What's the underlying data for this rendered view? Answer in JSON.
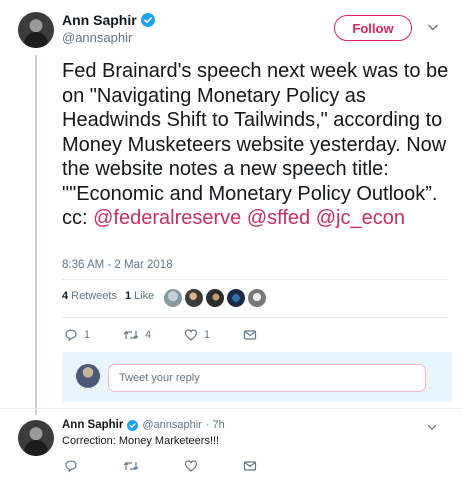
{
  "tweet": {
    "author_name": "Ann Saphir",
    "author_handle": "@annsaphir",
    "follow_label": "Follow",
    "text_parts": [
      "Fed Brainard's speech next week was to be on \"Navigating Monetary Policy as Headwinds Shift to Tailwinds,\" according to Money Musketeers website yesterday. Now the website notes a new speech title:  \"\"Economic and Monetary Policy Outlook”. cc: "
    ],
    "mentions": [
      "@federalreserve",
      "@sffed",
      "@jc_econ"
    ],
    "timestamp": "8:36 AM - 2 Mar 2018",
    "stats": {
      "retweets_count": "4",
      "retweets_label": "Retweets",
      "likes_count": "1",
      "likes_label": "Like"
    },
    "actions": {
      "reply_count": "1",
      "retweet_count": "4",
      "like_count": "1"
    }
  },
  "reply_box": {
    "placeholder": "Tweet your reply"
  },
  "reply_tweet": {
    "author_name": "Ann Saphir",
    "author_handle": "@annsaphir",
    "age": "· 7h",
    "text": "Correction: Money Marketeers!!!"
  },
  "colors": {
    "accent": "#e0245e",
    "verified": "#1da1f2",
    "mention": "#c7305f",
    "secondary_text": "#657786"
  },
  "icons": [
    "verified-badge-icon",
    "chevron-down-icon",
    "reply-icon",
    "retweet-icon",
    "heart-icon",
    "direct-message-icon"
  ]
}
